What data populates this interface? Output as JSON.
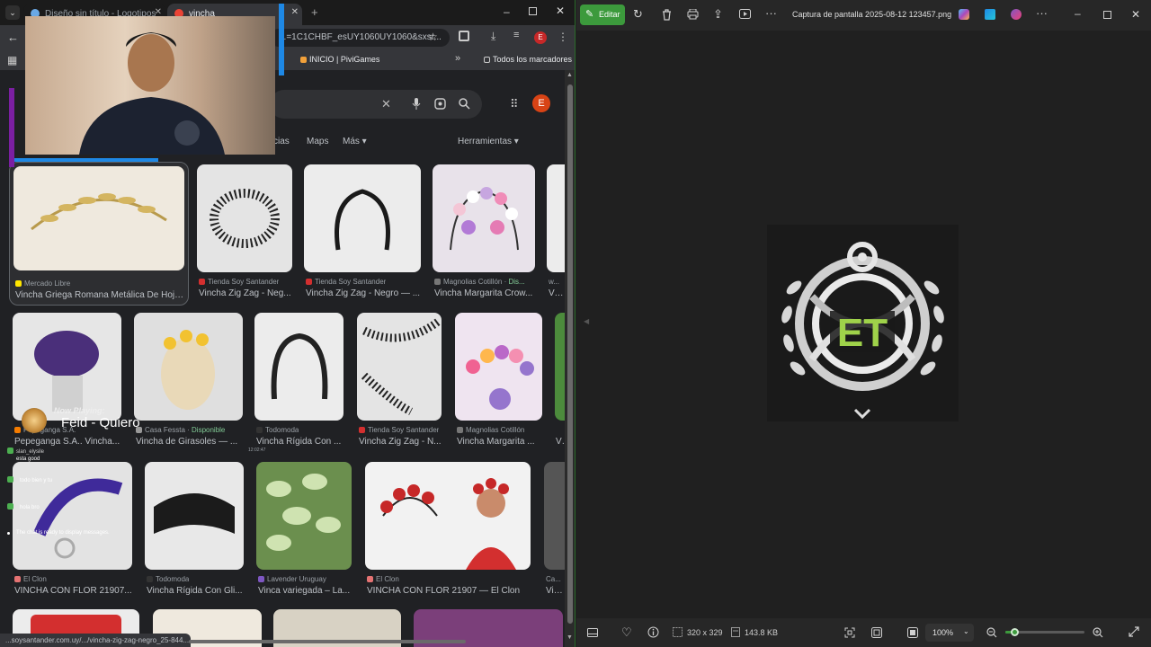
{
  "browser": {
    "tabs": [
      {
        "label": "Diseño sin título - Logotipos"
      },
      {
        "label": "vincha"
      }
    ],
    "url": "...=1C1CHBF_esUY1060UY1060&sxsr...",
    "avatar_letter": "E",
    "bookmarks": [
      {
        "label": "INICIO | PiviGames"
      }
    ],
    "all_bookmarks_label": "Todos los marcadores",
    "google": {
      "avatar_letter": "E",
      "filters": [
        "cias",
        "Maps",
        "Más"
      ],
      "tools_label": "Herramientas"
    },
    "status_url": "...soysantander.com.uy/.../vincha-zig-zag-negro_25-844...",
    "results": [
      {
        "source": "Mercado Libre",
        "title": "Vincha Griega Romana Metálica De Hoja..."
      },
      {
        "source": "Tienda Soy Santander",
        "title": "Vincha Zig Zag - Neg..."
      },
      {
        "source": "Tienda Soy Santander",
        "title": "Vincha Zig Zag - Negro — ..."
      },
      {
        "source": "Magnolias Cotillón",
        "source_extra": "Dis...",
        "title": "Vincha Margarita Crow..."
      },
      {
        "source": "w...",
        "title": "Vinc..."
      },
      {
        "source": "Pepeganga S.A.",
        "title": "Pepeganga S.A.. Vincha..."
      },
      {
        "source": "Casa Fessta",
        "source_extra": "Disponible",
        "title": "Vincha de Girasoles — ..."
      },
      {
        "source": "Todomoda",
        "title": "Vincha Rígida Con ..."
      },
      {
        "source": "Tienda Soy Santander",
        "title": "Vincha Zig Zag - N..."
      },
      {
        "source": "Magnolias Cotillón",
        "title": "Vincha Margarita ..."
      },
      {
        "source": "",
        "title": "Vi..."
      },
      {
        "source": "El Clon",
        "title": "VINCHA CON FLOR 21907..."
      },
      {
        "source": "Todomoda",
        "title": "Vincha Rígida Con Gli..."
      },
      {
        "source": "Lavender Uruguay",
        "title": "Vinca variegada – La..."
      },
      {
        "source": "El Clon",
        "title": "VINCHA CON FLOR 21907 — El Clon"
      },
      {
        "source": "Ca...",
        "title": "Vinc..."
      }
    ]
  },
  "overlay": {
    "now_playing_label": "Now Playing:",
    "now_playing_track": "Feid - Quiero",
    "chat": [
      {
        "user": "slan_elysile",
        "message": "esta good"
      },
      {
        "user": "",
        "message": "todo bien y tu"
      },
      {
        "user": "",
        "message": "hola bro"
      },
      {
        "user": "",
        "message": "The chat is ready to display messages."
      }
    ],
    "chat_time": "12:02:47"
  },
  "viewer": {
    "edit_label": "Editar",
    "file_name": "Captura de pantalla 2025-08-12 123457.png",
    "logo_text": "ET",
    "dimensions": "320 x 329",
    "file_size": "143.8 KB",
    "zoom": "100%",
    "zoom_level": 0.12
  },
  "colors": {
    "edit_green": "#3c9a3c",
    "logo_green": "#9fd24a",
    "google_avatar": "#d84315",
    "in_stock": "#81c995"
  },
  "icons": {
    "search": "search-icon",
    "mic": "mic-icon",
    "lens": "lens-icon",
    "apps": "apps-icon",
    "star": "star-icon",
    "print": "print-icon",
    "trash": "trash-icon",
    "heart": "heart-icon"
  }
}
